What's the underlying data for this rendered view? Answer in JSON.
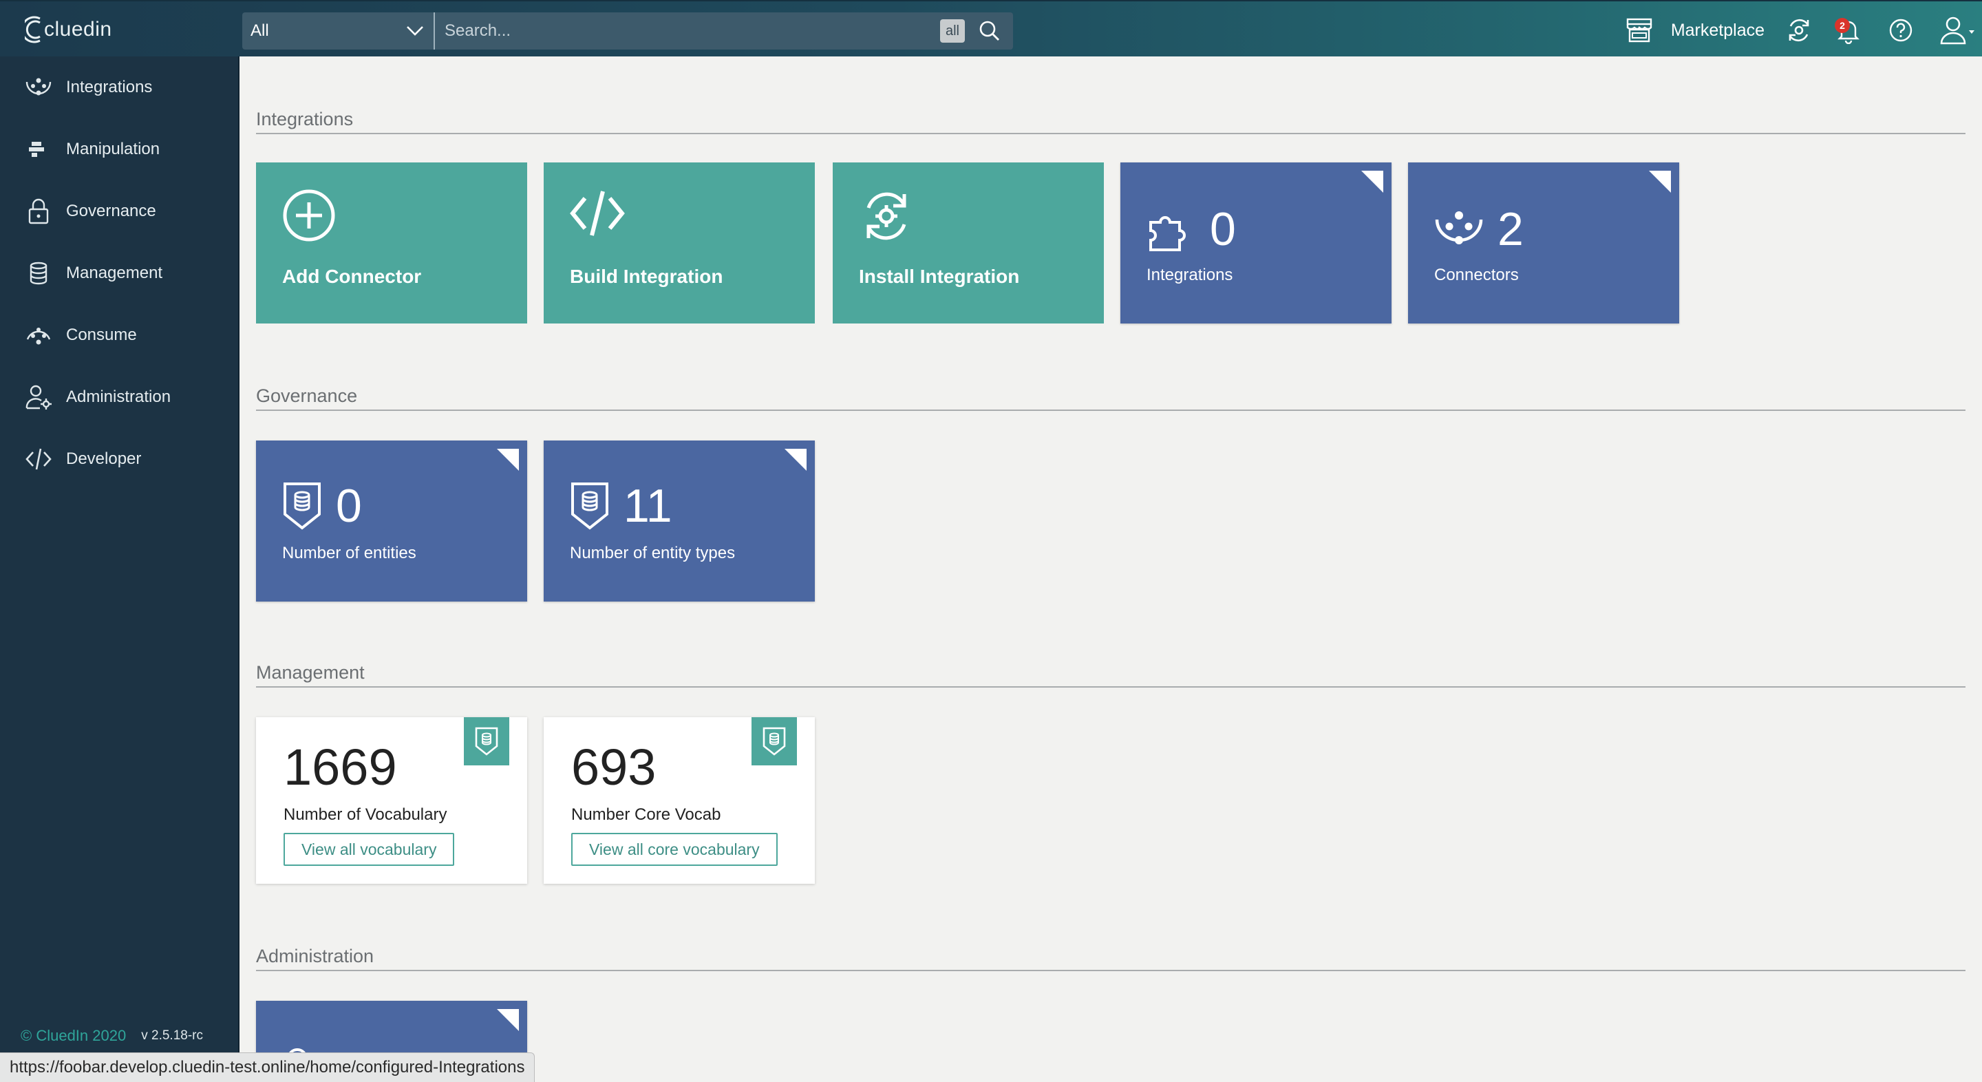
{
  "app": {
    "name": "cluedin"
  },
  "search": {
    "scope": "All",
    "placeholder": "Search...",
    "scope_badge": "all"
  },
  "topbar": {
    "marketplace_label": "Marketplace",
    "notifications_count": "2"
  },
  "sidebar": {
    "items": [
      {
        "label": "Integrations",
        "icon": "integrations-icon"
      },
      {
        "label": "Manipulation",
        "icon": "manipulation-icon"
      },
      {
        "label": "Governance",
        "icon": "lock-icon"
      },
      {
        "label": "Management",
        "icon": "database-icon"
      },
      {
        "label": "Consume",
        "icon": "consume-icon"
      },
      {
        "label": "Administration",
        "icon": "user-gear-icon"
      },
      {
        "label": "Developer",
        "icon": "code-icon"
      }
    ],
    "footer": {
      "copyright": "© CluedIn 2020",
      "version": "v 2.5.18-rc"
    }
  },
  "sections": {
    "integrations": {
      "title": "Integrations",
      "actions": [
        {
          "label": "Add Connector",
          "icon": "plus-circle-icon"
        },
        {
          "label": "Build Integration",
          "icon": "code-icon"
        },
        {
          "label": "Install Integration",
          "icon": "gear-refresh-icon"
        }
      ],
      "stats": [
        {
          "value": "0",
          "label": "Integrations",
          "icon": "puzzle-icon"
        },
        {
          "value": "2",
          "label": "Connectors",
          "icon": "connectors-icon"
        }
      ]
    },
    "governance": {
      "title": "Governance",
      "stats": [
        {
          "value": "0",
          "label": "Number of entities",
          "icon": "shield-database-icon"
        },
        {
          "value": "11",
          "label": "Number of entity types",
          "icon": "shield-database-icon"
        }
      ]
    },
    "management": {
      "title": "Management",
      "cards": [
        {
          "value": "1669",
          "label": "Number of Vocabulary",
          "button": "View all vocabulary"
        },
        {
          "value": "693",
          "label": "Number Core Vocab",
          "button": "View all core vocabulary"
        }
      ]
    },
    "administration": {
      "title": "Administration"
    }
  },
  "status_bar": {
    "url": "https://foobar.develop.cluedin-test.online/home/configured-Integrations"
  },
  "colors": {
    "sidebar_bg": "#1c3344",
    "action_tile": "#4da79c",
    "stat_tile": "#4b67a1",
    "notification": "#d9342b"
  }
}
